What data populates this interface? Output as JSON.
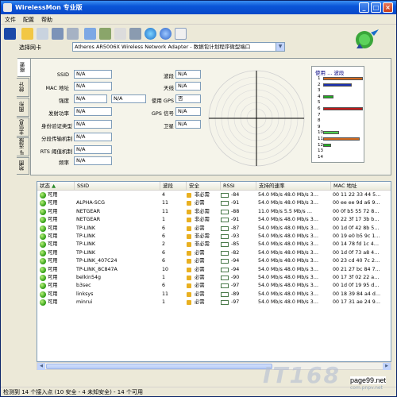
{
  "window": {
    "title": "WirelessMon 专业版",
    "buttons": [
      "_",
      "□",
      "×"
    ]
  },
  "menu": [
    "文件",
    "配置",
    "帮助"
  ],
  "toolbar_icons": [
    "save-icon",
    "open-folder-icon",
    "list-icon",
    "network-icon",
    "disconnect-icon",
    "wand-icon",
    "print-icon",
    "check-icon",
    "tools-icon",
    "globe-icon",
    "info-icon",
    "mail-icon"
  ],
  "adapter": {
    "label": "选择网卡",
    "value": "Atheros AR5006X Wireless Network Adapter - 数据包计划程序微型端口"
  },
  "tabs": [
    "概要",
    "统计",
    "图形",
    "主信息",
    "IP 连接",
    "地图"
  ],
  "summary": {
    "left": [
      {
        "label": "SSID",
        "value": "N/A"
      },
      {
        "label": "MAC 地址",
        "value": "N/A"
      },
      {
        "label": "强度",
        "value": "N/A",
        "value2": "N/A"
      },
      {
        "label": "发射功率",
        "value": "N/A"
      },
      {
        "label": "身份验证类型",
        "value": "N/A"
      },
      {
        "label": "分段传输机制",
        "value": "N/A"
      },
      {
        "label": "RTS 阈值机制",
        "value": "N/A"
      },
      {
        "label": "频率",
        "value": "N/A"
      }
    ],
    "right": [
      {
        "label": "波段",
        "value": "N/A"
      },
      {
        "label": "天线",
        "value": "N/A"
      },
      {
        "label": "使用 GPS",
        "value": "否"
      },
      {
        "label": "GPS 信号",
        "value": "N/A"
      },
      {
        "label": "卫星",
        "value": "N/A"
      }
    ]
  },
  "usage_chart": {
    "legend": "使用 ... 波段",
    "channels": [
      "1",
      "2",
      "3",
      "4",
      "5",
      "6",
      "7",
      "8",
      "9",
      "10",
      "11",
      "12",
      "13",
      "14"
    ],
    "bars": [
      {
        "channel": 1,
        "level": 1.0,
        "color": "#d2691e"
      },
      {
        "channel": 2,
        "level": 0.72,
        "color": "#1a2fb0"
      },
      {
        "channel": 4,
        "level": 0.25,
        "color": "#22aa22"
      },
      {
        "channel": 6,
        "level": 1.0,
        "color": "#c01818"
      },
      {
        "channel": 10,
        "level": 0.4,
        "color": "#4fd04f"
      },
      {
        "channel": 11,
        "level": 0.92,
        "color": "#d2691e"
      },
      {
        "channel": 12,
        "level": 0.2,
        "color": "#20b020"
      }
    ]
  },
  "list": {
    "columns": [
      "状态",
      "SSID",
      "波段",
      "安全",
      "RSSI",
      "支持的速率",
      "MAC 地址"
    ],
    "rows": [
      {
        "status": "可用",
        "ssid": "",
        "ch": "4",
        "sec": "非必需",
        "rssi": "-84",
        "rates": "54.0 Mb/s  48.0 Mb/s  3…",
        "mac": "00 11 22 33 44 5…"
      },
      {
        "status": "可用",
        "ssid": "ALPHA-SCG",
        "ch": "11",
        "sec": "必需",
        "rssi": "-91",
        "rates": "54.0 Mb/s  48.0 Mb/s  3…",
        "mac": "00 ee ee 9d a6 9…"
      },
      {
        "status": "可用",
        "ssid": "NETGEAR",
        "ch": "11",
        "sec": "非必需",
        "rssi": "-88",
        "rates": "11.0 Mb/s  5.5 Mb/s  …",
        "mac": "00 0f b5 55 72 8…"
      },
      {
        "status": "可用",
        "ssid": "NETGEAR",
        "ch": "1",
        "sec": "非必需",
        "rssi": "-91",
        "rates": "54.0 Mb/s  48.0 Mb/s  3…",
        "mac": "00 22 3f 17 3b b…"
      },
      {
        "status": "可用",
        "ssid": "TP-LINK",
        "ch": "6",
        "sec": "必需",
        "rssi": "-87",
        "rates": "54.0 Mb/s  48.0 Mb/s  3…",
        "mac": "00 1d 0f 42 8b 5…"
      },
      {
        "status": "可用",
        "ssid": "TP-LINK",
        "ch": "6",
        "sec": "非必需",
        "rssi": "-93",
        "rates": "54.0 Mb/s  48.0 Mb/s  3…",
        "mac": "00 19 e0 b5 9c 1…"
      },
      {
        "status": "可用",
        "ssid": "TP-LINK",
        "ch": "2",
        "sec": "非必需",
        "rssi": "-85",
        "rates": "54.0 Mb/s  48.0 Mb/s  3…",
        "mac": "00 14 78 fd 1c 4…"
      },
      {
        "status": "可用",
        "ssid": "TP-LINK",
        "ch": "6",
        "sec": "必需",
        "rssi": "-82",
        "rates": "54.0 Mb/s  48.0 Mb/s  3…",
        "mac": "00 1d 0f 73 a8 4…"
      },
      {
        "status": "可用",
        "ssid": "TP-LINK_407C24",
        "ch": "6",
        "sec": "必需",
        "rssi": "-94",
        "rates": "54.0 Mb/s  48.0 Mb/s  3…",
        "mac": "00 23 cd 40 7c 2…"
      },
      {
        "status": "可用",
        "ssid": "TP-LINK_8C847A",
        "ch": "10",
        "sec": "必需",
        "rssi": "-94",
        "rates": "54.0 Mb/s  48.0 Mb/s  3…",
        "mac": "00 21 27 bc 84 7…"
      },
      {
        "status": "可用",
        "ssid": "belkin54g",
        "ch": "1",
        "sec": "必需",
        "rssi": "-90",
        "rates": "54.0 Mb/s  48.0 Mb/s  3…",
        "mac": "00 17 3f 02 22 a…"
      },
      {
        "status": "可用",
        "ssid": "b3sec",
        "ch": "6",
        "sec": "必需",
        "rssi": "-97",
        "rates": "54.0 Mb/s  48.0 Mb/s  3…",
        "mac": "00 1d 0f 19 95 d…"
      },
      {
        "status": "可用",
        "ssid": "linksys",
        "ch": "11",
        "sec": "必需",
        "rssi": "-89",
        "rates": "54.0 Mb/s  48.0 Mb/s  3…",
        "mac": "00 18 39 84 a4 d…"
      },
      {
        "status": "可用",
        "ssid": "minrui",
        "ch": "1",
        "sec": "必需",
        "rssi": "-97",
        "rates": "54.0 Mb/s  48.0 Mb/s  3…",
        "mac": "00 17 31 ae 24 9…"
      }
    ]
  },
  "statusbar": "检测到 14 个接入点 (10 安全 - 4 未知安全) - 14 个可用",
  "watermark": {
    "logo": "IT168",
    "domain": "page99.net",
    "sub": "com.pnpv.net"
  }
}
